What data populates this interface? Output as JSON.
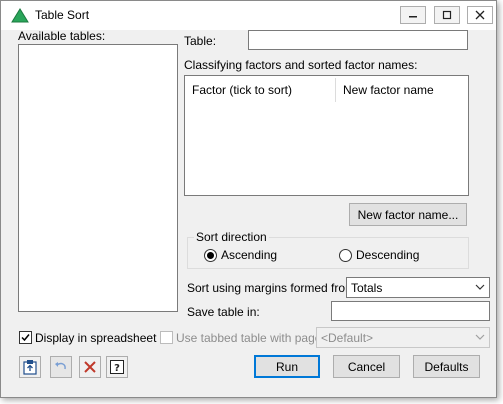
{
  "window": {
    "title": "Table Sort",
    "controls": {
      "minimize": "minimize",
      "maximize": "maximize",
      "close": "close"
    }
  },
  "left": {
    "available_tables_label": "Available tables:",
    "display_in_spreadsheet_label": "Display in spreadsheet",
    "display_in_spreadsheet_checked": true
  },
  "right": {
    "table_label": "Table:",
    "table_value": "",
    "classifying_label": "Classifying factors and sorted factor names:",
    "grid_headers": [
      "Factor (tick to sort)",
      "New factor name"
    ],
    "new_factor_name_button": "New factor name...",
    "sort_direction": {
      "title": "Sort direction",
      "options": [
        "Ascending",
        "Descending"
      ],
      "selected": "Ascending"
    },
    "margins_label": "Sort using margins formed from:",
    "margins_value": "Totals",
    "save_table_label": "Save table in:",
    "save_table_value": "",
    "tabbed_label": "Use tabbed table with pages:",
    "tabbed_value": "<Default>",
    "tabbed_checked": false
  },
  "footer": {
    "run": "Run",
    "cancel": "Cancel",
    "defaults": "Defaults"
  },
  "colors": {
    "accent": "#0078d7",
    "icon_green": "#2aa55a",
    "clear_red": "#c0392b"
  }
}
